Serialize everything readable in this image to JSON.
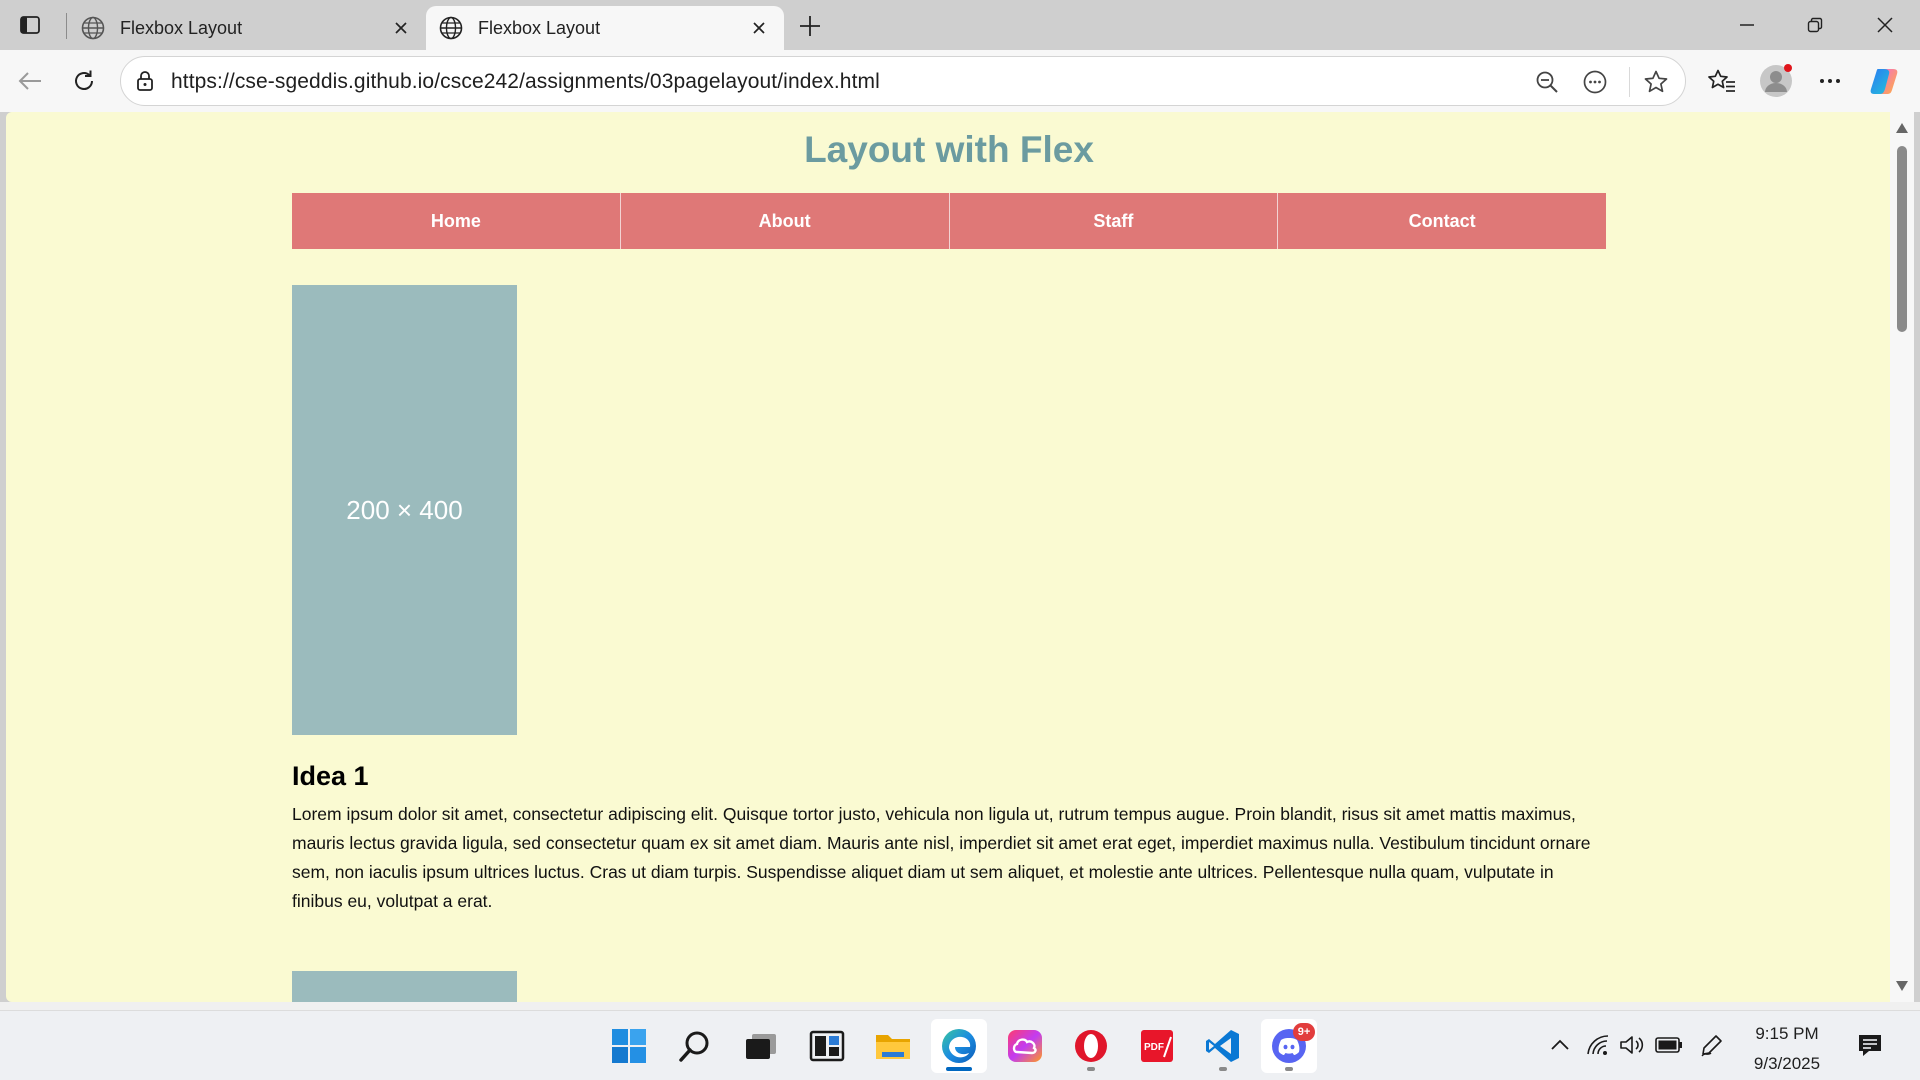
{
  "browser": {
    "tabs": [
      {
        "title": "Flexbox Layout",
        "active": false
      },
      {
        "title": "Flexbox Layout",
        "active": true
      }
    ],
    "url": "https://cse-sgeddis.github.io/csce242/assignments/03pagelayout/index.html"
  },
  "page": {
    "title": "Layout with Flex",
    "nav": [
      {
        "label": "Home"
      },
      {
        "label": "About"
      },
      {
        "label": "Staff"
      },
      {
        "label": "Contact"
      }
    ],
    "placeholder_label": "200 × 400",
    "idea": {
      "heading": "Idea 1",
      "text": "Lorem ipsum dolor sit amet, consectetur adipiscing elit. Quisque tortor justo, vehicula non ligula ut, rutrum tempus augue. Proin blandit, risus sit amet mattis maximus, mauris lectus gravida ligula, sed consectetur quam ex sit amet diam. Mauris ante nisl, imperdiet sit amet erat eget, imperdiet maximus nulla. Vestibulum tincidunt ornare sem, non iaculis ipsum ultrices luctus. Cras ut diam turpis. Suspendisse aliquet diam ut sem aliquet, et molestie ante ultrices. Pellentesque nulla quam, vulputate in finibus eu, volutpat a erat."
    }
  },
  "colors": {
    "page_bg": "#fafad2",
    "title": "#6b9ba0",
    "nav_bg": "#df7877",
    "placeholder": "#9bbbbd"
  },
  "taskbar": {
    "apps": [
      {
        "name": "start-icon"
      },
      {
        "name": "search-icon"
      },
      {
        "name": "task-view-icon"
      },
      {
        "name": "widgets-icon"
      },
      {
        "name": "file-explorer-icon"
      },
      {
        "name": "edge-icon",
        "active": true
      },
      {
        "name": "creative-cloud-icon"
      },
      {
        "name": "opera-icon"
      },
      {
        "name": "pdf-editor-icon"
      },
      {
        "name": "vscode-icon"
      },
      {
        "name": "discord-icon",
        "badge": "9+"
      }
    ],
    "clock": {
      "time": "9:15 PM",
      "date": "9/3/2025"
    }
  }
}
